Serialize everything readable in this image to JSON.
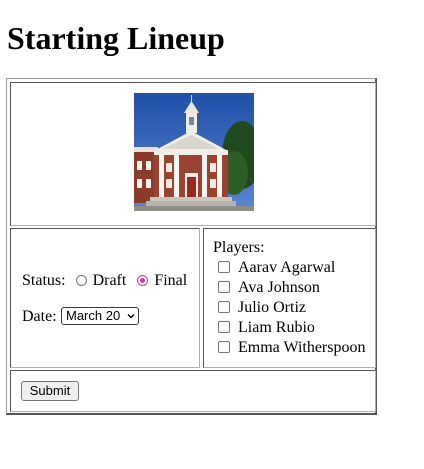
{
  "page": {
    "title": "Starting Lineup"
  },
  "photo": {
    "icon": "school-building-photo"
  },
  "status": {
    "label": "Status:",
    "options": [
      {
        "label": "Draft",
        "checked": false
      },
      {
        "label": "Final",
        "checked": true
      }
    ]
  },
  "date": {
    "label": "Date:",
    "selected": "March 20"
  },
  "players": {
    "label": "Players:",
    "items": [
      {
        "label": "Aarav Agarwal",
        "checked": false
      },
      {
        "label": "Ava Johnson",
        "checked": false
      },
      {
        "label": "Julio Ortiz",
        "checked": false
      },
      {
        "label": "Liam Rubio",
        "checked": false
      },
      {
        "label": "Emma Witherspoon",
        "checked": false
      }
    ]
  },
  "form": {
    "submit_label": "Submit"
  },
  "colors": {
    "radio_accent": "#d63a9a"
  }
}
